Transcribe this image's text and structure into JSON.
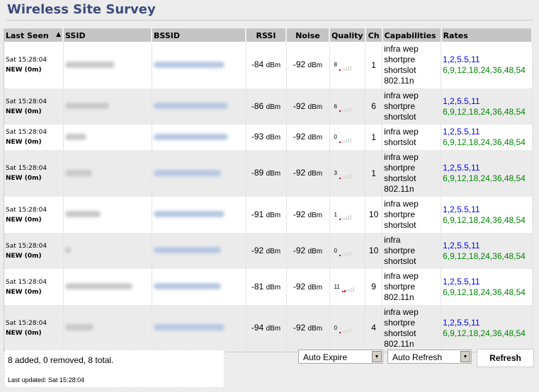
{
  "title": "Wireless Site Survey",
  "headers": {
    "last_seen": "Last Seen",
    "sort": "▲",
    "ssid": "SSID",
    "bssid": "BSSID",
    "rssi": "RSSI",
    "noise": "Noise",
    "quality": "Quality",
    "ch": "Ch",
    "cap": "Capabilities",
    "rates": "Rates"
  },
  "unit": "dBm",
  "rows": [
    {
      "time": "Sat 15:28:04",
      "status": "NEW (0m)",
      "rssi": "-84",
      "noise": "-92",
      "quality": "8",
      "ch": "1",
      "cap": [
        "infra wep",
        "shortpre",
        "shortslot",
        "802.11n"
      ],
      "r1": "1,2,5.5,11",
      "r2": "6,9,12,18,24,36,48,54"
    },
    {
      "time": "Sat 15:28:04",
      "status": "NEW (0m)",
      "rssi": "-86",
      "noise": "-92",
      "quality": "6",
      "ch": "6",
      "cap": [
        "infra wep",
        "shortpre",
        "shortslot"
      ],
      "r1": "1,2,5.5,11",
      "r2": "6,9,12,18,24,36,48,54"
    },
    {
      "time": "Sat 15:28:04",
      "status": "NEW (0m)",
      "rssi": "-93",
      "noise": "-92",
      "quality": "0",
      "ch": "1",
      "cap": [
        "infra wep",
        "shortslot"
      ],
      "r1": "1,2,5.5,11",
      "r2": "6,9,12,18,24,36,48,54"
    },
    {
      "time": "Sat 15:28:04",
      "status": "NEW (0m)",
      "rssi": "-89",
      "noise": "-92",
      "quality": "3",
      "ch": "1",
      "cap": [
        "infra wep",
        "shortpre",
        "shortslot",
        "802.11n"
      ],
      "r1": "1,2,5.5,11",
      "r2": "6,9,12,18,24,36,48,54"
    },
    {
      "time": "Sat 15:28:04",
      "status": "NEW (0m)",
      "rssi": "-91",
      "noise": "-92",
      "quality": "1",
      "ch": "10",
      "cap": [
        "infra wep",
        "shortpre",
        "shortslot"
      ],
      "r1": "1,2,5.5,11",
      "r2": "6,9,12,18,24,36,48,54"
    },
    {
      "time": "Sat 15:28:04",
      "status": "NEW (0m)",
      "rssi": "-92",
      "noise": "-92",
      "quality": "0",
      "ch": "10",
      "cap": [
        "infra",
        "shortpre",
        "shortslot"
      ],
      "r1": "1,2,5.5,11",
      "r2": "6,9,12,18,24,36,48,54"
    },
    {
      "time": "Sat 15:28:04",
      "status": "NEW (0m)",
      "rssi": "-81",
      "noise": "-92",
      "quality": "11",
      "ch": "9",
      "cap": [
        "infra wep",
        "shortpre",
        "802.11n"
      ],
      "r1": "1,2,5.5,11",
      "r2": "6,9,12,18,24,36,48,54"
    },
    {
      "time": "Sat 15:28:04",
      "status": "NEW (0m)",
      "rssi": "-94",
      "noise": "-92",
      "quality": "0",
      "ch": "4",
      "cap": [
        "infra wep",
        "shortpre",
        "shortslot",
        "802.11n"
      ],
      "r1": "1,2,5.5,11",
      "r2": "6,9,12,18,24,36,48,54"
    }
  ],
  "footer": {
    "summary": "8 added, 0 removed, 8 total.",
    "updated": "Last updated: Sat 15:28:04",
    "auto_expire": "Auto Expire",
    "auto_refresh": "Auto Refresh",
    "refresh": "Refresh"
  }
}
